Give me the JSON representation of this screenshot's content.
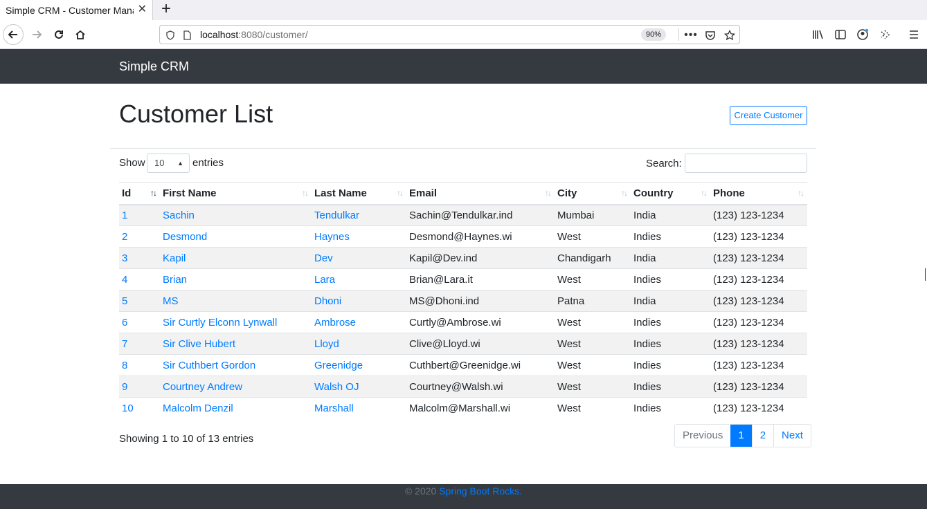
{
  "browser": {
    "tab_title": "Simple CRM - Customer Mana",
    "url_host": "localhost",
    "url_rest": ":8080/customer/",
    "zoom": "90%"
  },
  "navbar": {
    "brand": "Simple CRM"
  },
  "page": {
    "title": "Customer List",
    "create_label": "Create Customer",
    "show_label": "Show",
    "entries_label": "entries",
    "page_length": "10",
    "search_label": "Search:",
    "search_value": ""
  },
  "table": {
    "columns": [
      "Id",
      "First Name",
      "Last Name",
      "Email",
      "City",
      "Country",
      "Phone"
    ],
    "rows": [
      [
        "1",
        "Sachin",
        "Tendulkar",
        "Sachin@Tendulkar.ind",
        "Mumbai",
        "India",
        "(123) 123-1234"
      ],
      [
        "2",
        "Desmond",
        "Haynes",
        "Desmond@Haynes.wi",
        "West",
        "Indies",
        "(123) 123-1234"
      ],
      [
        "3",
        "Kapil",
        "Dev",
        "Kapil@Dev.ind",
        "Chandigarh",
        "India",
        "(123) 123-1234"
      ],
      [
        "4",
        "Brian",
        "Lara",
        "Brian@Lara.it",
        "West",
        "Indies",
        "(123) 123-1234"
      ],
      [
        "5",
        "MS",
        "Dhoni",
        "MS@Dhoni.ind",
        "Patna",
        "India",
        "(123) 123-1234"
      ],
      [
        "6",
        "Sir Curtly Elconn Lynwall",
        "Ambrose",
        "Curtly@Ambrose.wi",
        "West",
        "Indies",
        "(123) 123-1234"
      ],
      [
        "7",
        "Sir Clive Hubert",
        "Lloyd",
        "Clive@Lloyd.wi",
        "West",
        "Indies",
        "(123) 123-1234"
      ],
      [
        "8",
        "Sir Cuthbert Gordon",
        "Greenidge",
        "Cuthbert@Greenidge.wi",
        "West",
        "Indies",
        "(123) 123-1234"
      ],
      [
        "9",
        "Courtney Andrew",
        "Walsh OJ",
        "Courtney@Walsh.wi",
        "West",
        "Indies",
        "(123) 123-1234"
      ],
      [
        "10",
        "Malcolm Denzil",
        "Marshall",
        "Malcolm@Marshall.wi",
        "West",
        "Indies",
        "(123) 123-1234"
      ]
    ]
  },
  "info_text": "Showing 1 to 10 of 13 entries",
  "pagination": {
    "previous": "Previous",
    "pages": [
      "1",
      "2"
    ],
    "active_page": "1",
    "next": "Next"
  },
  "footer": {
    "prefix": "© 2020",
    "link_text": "Spring Boot Rocks."
  },
  "colors": {
    "navbar_bg": "#343a40",
    "link": "#007bff"
  }
}
